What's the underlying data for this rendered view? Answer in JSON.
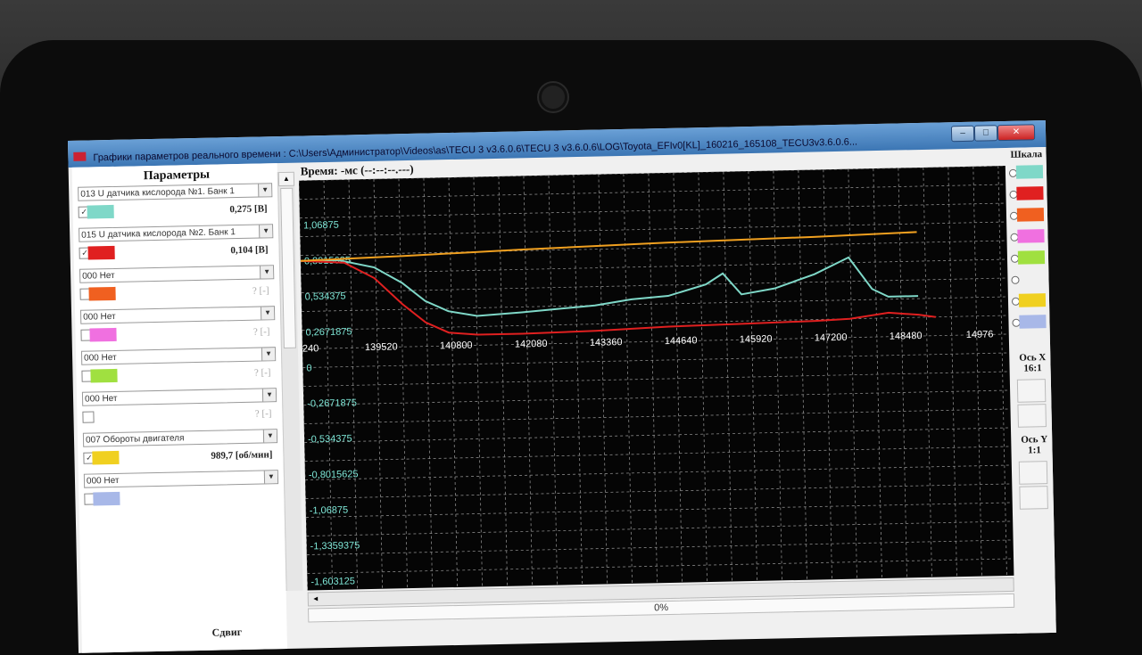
{
  "window": {
    "title": "Графики параметров реального времени : C:\\Users\\Администратор\\Videos\\as\\TECU 3 v3.6.0.6\\TECU 3 v3.6.0.6\\LOG\\Toyota_EFIv0[KL]_160216_165108_TECU3v3.6.0.6..."
  },
  "left_panel": {
    "title": "Параметры",
    "params": [
      {
        "select": "013 U датчика кислорода №1. Банк 1",
        "checked": true,
        "color": "#7fd8c8",
        "value": "0,275 [В]",
        "dim": false
      },
      {
        "select": "015 U датчика кислорода №2. Банк 1",
        "checked": true,
        "color": "#e02020",
        "value": "0,104 [В]",
        "dim": false
      },
      {
        "select": "000 Нет",
        "checked": false,
        "color": "#f06020",
        "value": "? [-]",
        "dim": true
      },
      {
        "select": "000 Нет",
        "checked": false,
        "color": "#f070e0",
        "value": "? [-]",
        "dim": true
      },
      {
        "select": "000 Нет",
        "checked": false,
        "color": "#a0e040",
        "value": "? [-]",
        "dim": true
      },
      {
        "select": "000 Нет",
        "checked": false,
        "color": "",
        "value": "? [-]",
        "dim": true
      },
      {
        "select": "007 Обороты двигателя",
        "checked": true,
        "color": "#f0d020",
        "value": "989,7 [об/мин]",
        "dim": false
      },
      {
        "select": "000 Нет",
        "checked": false,
        "color": "#a8b8e8",
        "value": "",
        "dim": true
      }
    ]
  },
  "time_label": "Время: -мс (--:--:--.---)",
  "shift_label": "Сдвиг",
  "progress_text": "0%",
  "right_panel": {
    "title": "Шкала",
    "swatches": [
      "#7fd8c8",
      "#e02020",
      "#f06020",
      "#f070e0",
      "#a0e040",
      "",
      "#f0d020",
      "#a8b8e8"
    ],
    "axis_x_label": "Ось X",
    "axis_x_value": "16:1",
    "axis_y_label": "Ось Y",
    "axis_y_value": "1:1"
  },
  "chart_data": {
    "type": "line",
    "x_ticks": [
      "240",
      "139520",
      "140800",
      "142080",
      "143360",
      "144640",
      "145920",
      "147200",
      "148480",
      "14976"
    ],
    "y_ticks": [
      "1,06875",
      "0,8015625",
      "0,534375",
      "0,2671875",
      "0",
      "-0,2671875",
      "-0,534375",
      "-0,8015625",
      "-1,06875",
      "-1,3359375",
      "-1,603125"
    ],
    "ylim": [
      -1.603125,
      1.3359375
    ],
    "series": [
      {
        "color": "#7fd8c8",
        "x": [
          138240,
          138900,
          139520,
          140000,
          140400,
          140800,
          141300,
          142080,
          143360,
          144000,
          144640,
          145300,
          145600,
          145920,
          146500,
          147200,
          147800,
          148200,
          148480,
          149000
        ],
        "y": [
          0.8,
          0.8,
          0.74,
          0.62,
          0.48,
          0.4,
          0.36,
          0.38,
          0.42,
          0.46,
          0.48,
          0.56,
          0.64,
          0.48,
          0.52,
          0.62,
          0.74,
          0.5,
          0.44,
          0.44
        ]
      },
      {
        "color": "#e02020",
        "x": [
          138240,
          139000,
          139520,
          140000,
          140400,
          140800,
          141300,
          142080,
          143360,
          144640,
          145920,
          147200,
          147800,
          148480,
          149000,
          149300
        ],
        "y": [
          0.8,
          0.78,
          0.66,
          0.46,
          0.32,
          0.24,
          0.22,
          0.22,
          0.23,
          0.25,
          0.26,
          0.27,
          0.28,
          0.32,
          0.3,
          0.28
        ]
      },
      {
        "color": "#f0a020",
        "x": [
          138240,
          140000,
          142080,
          144640,
          147200,
          149000
        ],
        "y": [
          0.8,
          0.82,
          0.85,
          0.88,
          0.9,
          0.92
        ]
      }
    ]
  }
}
